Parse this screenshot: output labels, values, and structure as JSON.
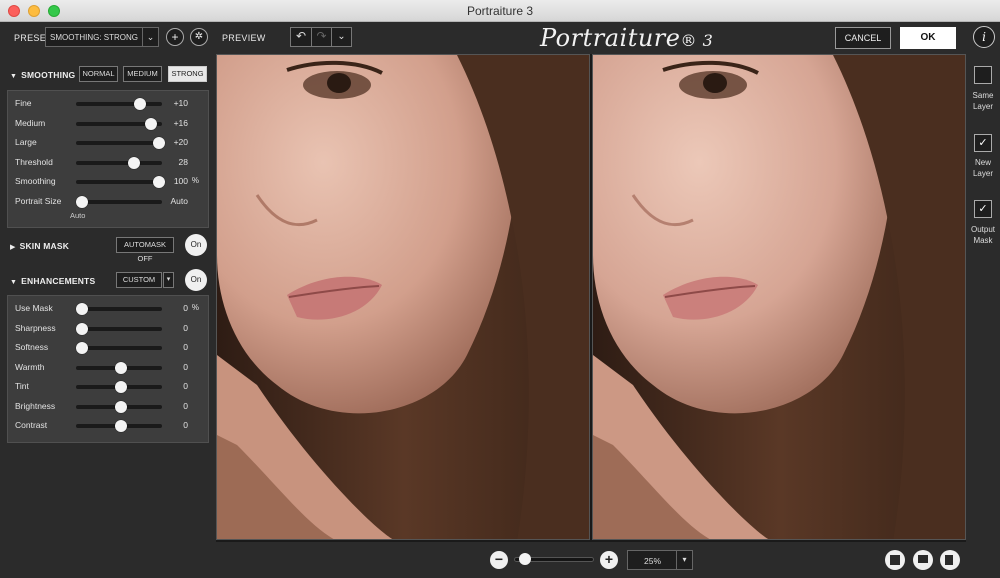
{
  "window": {
    "title": "Portraiture 3"
  },
  "toolbar": {
    "preset_label": "PRESET",
    "preset_value": "SMOOTHING: STRONG",
    "add_icon": "plus-icon",
    "settings_icon": "gear-icon",
    "preview_label": "PREVIEW",
    "logo_text": "Portraiture",
    "logo_version": "® 3",
    "cancel_label": "CANCEL",
    "ok_label": "OK",
    "info_label": "i"
  },
  "smoothing": {
    "title": "SMOOTHING",
    "modes": [
      "NORMAL",
      "MEDIUM",
      "STRONG"
    ],
    "active_mode": "STRONG",
    "sliders": [
      {
        "name": "Fine",
        "value": "+10",
        "unit": "",
        "level": 0.74
      },
      {
        "name": "Medium",
        "value": "+16",
        "unit": "",
        "level": 0.87
      },
      {
        "name": "Large",
        "value": "+20",
        "unit": "",
        "level": 0.97
      },
      {
        "name": "Threshold",
        "value": "28",
        "unit": "",
        "level": 0.68
      },
      {
        "name": "Smoothing",
        "value": "100",
        "unit": "%",
        "level": 0.97
      },
      {
        "name": "Portrait Size",
        "value": "Auto",
        "unit": "",
        "level": 0.07
      }
    ],
    "portrait_size_sub": "Auto"
  },
  "skin_mask": {
    "title": "SKIN MASK",
    "button": "AUTOMASK OFF",
    "toggle": "On"
  },
  "enhancements": {
    "title": "ENHANCEMENTS",
    "mode": "CUSTOM",
    "toggle": "On",
    "sliders": [
      {
        "name": "Use Mask",
        "value": "0",
        "unit": "%",
        "level": 0.07
      },
      {
        "name": "Sharpness",
        "value": "0",
        "unit": "",
        "level": 0.07
      },
      {
        "name": "Softness",
        "value": "0",
        "unit": "",
        "level": 0.07
      },
      {
        "name": "Warmth",
        "value": "0",
        "unit": "",
        "level": 0.52
      },
      {
        "name": "Tint",
        "value": "0",
        "unit": "",
        "level": 0.52
      },
      {
        "name": "Brightness",
        "value": "0",
        "unit": "",
        "level": 0.52
      },
      {
        "name": "Contrast",
        "value": "0",
        "unit": "",
        "level": 0.52
      }
    ]
  },
  "output": {
    "same_layer": {
      "label_1": "Same",
      "label_2": "Layer",
      "checked": false
    },
    "new_layer": {
      "label_1": "New",
      "label_2": "Layer",
      "checked": true
    },
    "output_mask": {
      "label_1": "Output",
      "label_2": "Mask",
      "checked": true
    }
  },
  "bottom": {
    "zoom_out_icon": "minus-icon",
    "zoom_in_icon": "plus-icon",
    "zoom_level": 0.12,
    "zoom_value": "25%",
    "view_modes": [
      "single-view-icon",
      "split-horizontal-icon",
      "split-vertical-icon"
    ]
  },
  "colors": {
    "panel": "#2b2b2b",
    "box": "#3d3d3d",
    "accent": "#ffffff"
  }
}
